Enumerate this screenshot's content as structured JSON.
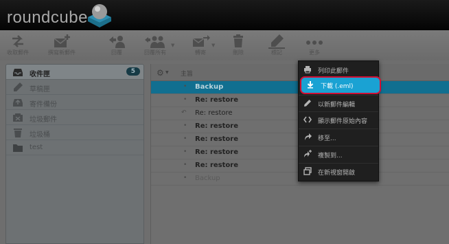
{
  "app": {
    "logo_text": "roundcube"
  },
  "toolbar": {
    "items": [
      {
        "name": "get-mail",
        "label": "收取郵件",
        "icon": "refresh-arrows-icon"
      },
      {
        "name": "compose",
        "label": "撰寫新郵件",
        "icon": "envelope-plus-icon"
      },
      {
        "name": "reply",
        "label": "回覆",
        "icon": "reply-person-icon"
      },
      {
        "name": "reply-all",
        "label": "回覆所有",
        "icon": "reply-all-persons-icon"
      },
      {
        "name": "forward",
        "label": "轉寄",
        "icon": "forward-envelope-icon"
      },
      {
        "name": "delete",
        "label": "刪除",
        "icon": "trash-icon"
      },
      {
        "name": "mark",
        "label": "標記",
        "icon": "pen-mark-icon"
      },
      {
        "name": "more",
        "label": "更多",
        "icon": "more-dots-icon"
      }
    ]
  },
  "folders": [
    {
      "label": "收件匣",
      "count": "5",
      "icon": "inbox-icon",
      "selected": true
    },
    {
      "label": "草稿匣",
      "icon": "pencil-icon"
    },
    {
      "label": "寄件備份",
      "icon": "sent-icon"
    },
    {
      "label": "垃圾郵件",
      "icon": "junk-icon"
    },
    {
      "label": "垃圾桶",
      "icon": "trash-icon"
    },
    {
      "label": "test",
      "icon": "folder-icon"
    }
  ],
  "messagelist": {
    "header_subject": "主旨",
    "rows": [
      {
        "subject": "Backup",
        "status": "unread-dot",
        "state": "selected"
      },
      {
        "subject": "Re: restore",
        "status": "unread-dot",
        "state": "unread"
      },
      {
        "subject": "Re: restore",
        "status": "replied-arrow",
        "state": "read"
      },
      {
        "subject": "Re: restore",
        "status": "unread-dot",
        "state": "unread"
      },
      {
        "subject": "Re: restore",
        "status": "unread-dot",
        "state": "unread"
      },
      {
        "subject": "Re: restore",
        "status": "unread-dot",
        "state": "unread"
      },
      {
        "subject": "Re: restore",
        "status": "unread-dot",
        "state": "unread"
      },
      {
        "subject": "Backup",
        "status": "unread-dot",
        "state": "faded"
      }
    ]
  },
  "more_menu": {
    "items": [
      {
        "label": "列印此郵件",
        "icon": "print-icon"
      },
      {
        "label": "下載 (.eml)",
        "icon": "download-arrow-icon",
        "active": true
      },
      {
        "label": "以新郵件編輯",
        "icon": "pencil-edit-icon"
      },
      {
        "label": "顯示郵件原始內容",
        "icon": "code-brackets-icon"
      },
      {
        "label": "移至...",
        "icon": "move-arrow-icon"
      },
      {
        "label": "複製到...",
        "icon": "copy-plus-icon"
      },
      {
        "label": "在新視窗開啟",
        "icon": "new-window-icon"
      }
    ]
  },
  "colors": {
    "selected_row": "#116f90",
    "menu_active": "#1aa2d3",
    "highlight_outline": "#d10f34",
    "header_bg": "#040404"
  }
}
